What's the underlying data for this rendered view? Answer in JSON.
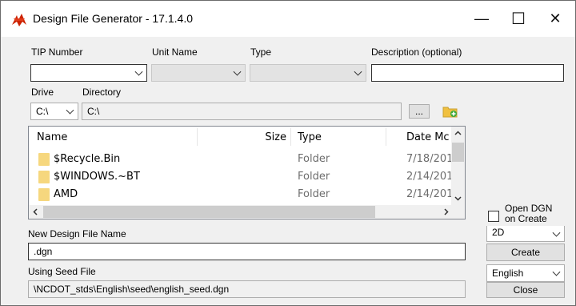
{
  "window": {
    "title": "Design File Generator - 17.1.4.0",
    "minimize": "—",
    "maximize": "☐",
    "close": "✕",
    "accent": "#cc2200"
  },
  "fields": {
    "tip_label": "TIP Number",
    "unit_label": "Unit Name",
    "type_label": "Type",
    "desc_label": "Description (optional)",
    "drive_label": "Drive",
    "dir_label": "Directory",
    "drive_value": "C:\\",
    "dir_value": "C:\\",
    "browse_label": "..."
  },
  "file_list": {
    "columns": [
      "Name",
      "Size",
      "Type",
      "Date Mc"
    ],
    "rows": [
      {
        "name": "$Recycle.Bin",
        "type": "Folder",
        "date": "7/18/201"
      },
      {
        "name": "$WINDOWS.~BT",
        "type": "Folder",
        "date": "2/14/201"
      },
      {
        "name": "AMD",
        "type": "Folder",
        "date": "2/14/201"
      }
    ]
  },
  "bottom": {
    "new_name_label": "New Design File Name",
    "new_name_value": ".dgn",
    "seed_label": "Using Seed File",
    "seed_value": "\\NCDOT_stds\\English\\seed\\english_seed.dgn"
  },
  "side": {
    "open_dgn_line1": "Open DGN",
    "open_dgn_line2": "on Create",
    "dim_value": "2D",
    "create_label": "Create",
    "units_value": "English",
    "close_label": "Close"
  }
}
